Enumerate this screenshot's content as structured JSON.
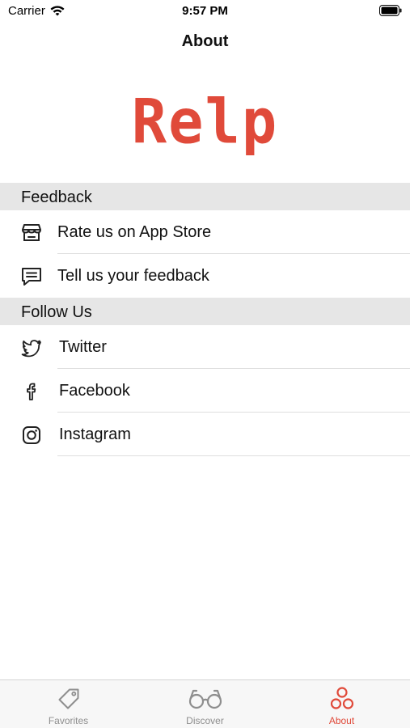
{
  "status_bar": {
    "carrier": "Carrier",
    "time": "9:57 PM"
  },
  "nav": {
    "title": "About"
  },
  "logo": {
    "text": "Relp",
    "color": "#e04a3a"
  },
  "sections": [
    {
      "header": "Feedback",
      "items": [
        {
          "label": "Rate us on App Store",
          "icon": "store-icon"
        },
        {
          "label": "Tell us your feedback",
          "icon": "chat-icon"
        }
      ]
    },
    {
      "header": "Follow Us",
      "items": [
        {
          "label": "Twitter",
          "icon": "twitter-icon"
        },
        {
          "label": "Facebook",
          "icon": "facebook-icon"
        },
        {
          "label": "Instagram",
          "icon": "instagram-icon"
        }
      ]
    }
  ],
  "tab_bar": {
    "tabs": [
      {
        "label": "Favorites",
        "icon": "tag-icon",
        "active": false
      },
      {
        "label": "Discover",
        "icon": "glasses-icon",
        "active": false
      },
      {
        "label": "About",
        "icon": "circles-icon",
        "active": true
      }
    ],
    "active_color": "#e04a3a",
    "inactive_color": "#8e8e8e"
  }
}
